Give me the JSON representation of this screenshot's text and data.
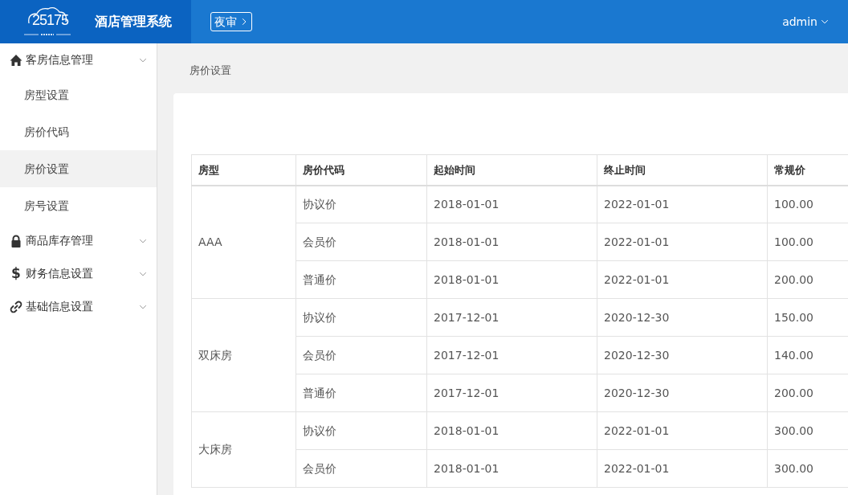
{
  "header": {
    "logo_text": "25175",
    "title": "酒店管理系统",
    "night_audit": "夜审",
    "user": "admin"
  },
  "sidebar": [
    {
      "label": "客房信息管理",
      "kind": "home",
      "children": [
        {
          "label": "房型设置",
          "selected": false
        },
        {
          "label": "房价代码",
          "selected": false
        },
        {
          "label": "房价设置",
          "selected": true
        },
        {
          "label": "房号设置",
          "selected": false
        }
      ]
    },
    {
      "label": "商品库存管理",
      "kind": "lock"
    },
    {
      "label": "财务信息设置",
      "kind": "dollar",
      "icon_text": "$"
    },
    {
      "label": "基础信息设置",
      "kind": "link"
    }
  ],
  "breadcrumb": "房价设置",
  "table": {
    "columns": [
      "房型",
      "房价代码",
      "起始时间",
      "终止时间",
      "常规价"
    ],
    "groups": [
      {
        "room_type": "AAA",
        "rates": [
          [
            "协议价",
            "2018-01-01",
            "2022-01-01",
            "100.00"
          ],
          [
            "会员价",
            "2018-01-01",
            "2022-01-01",
            "100.00"
          ],
          [
            "普通价",
            "2018-01-01",
            "2022-01-01",
            "200.00"
          ]
        ]
      },
      {
        "room_type": "双床房",
        "rates": [
          [
            "协议价",
            "2017-12-01",
            "2020-12-30",
            "150.00"
          ],
          [
            "会员价",
            "2017-12-01",
            "2020-12-30",
            "140.00"
          ],
          [
            "普通价",
            "2017-12-01",
            "2020-12-30",
            "200.00"
          ]
        ]
      },
      {
        "room_type": "大床房",
        "rates": [
          [
            "协议价",
            "2018-01-01",
            "2022-01-01",
            "300.00"
          ],
          [
            "会员价",
            "2018-01-01",
            "2022-01-01",
            "300.00"
          ]
        ]
      }
    ]
  }
}
